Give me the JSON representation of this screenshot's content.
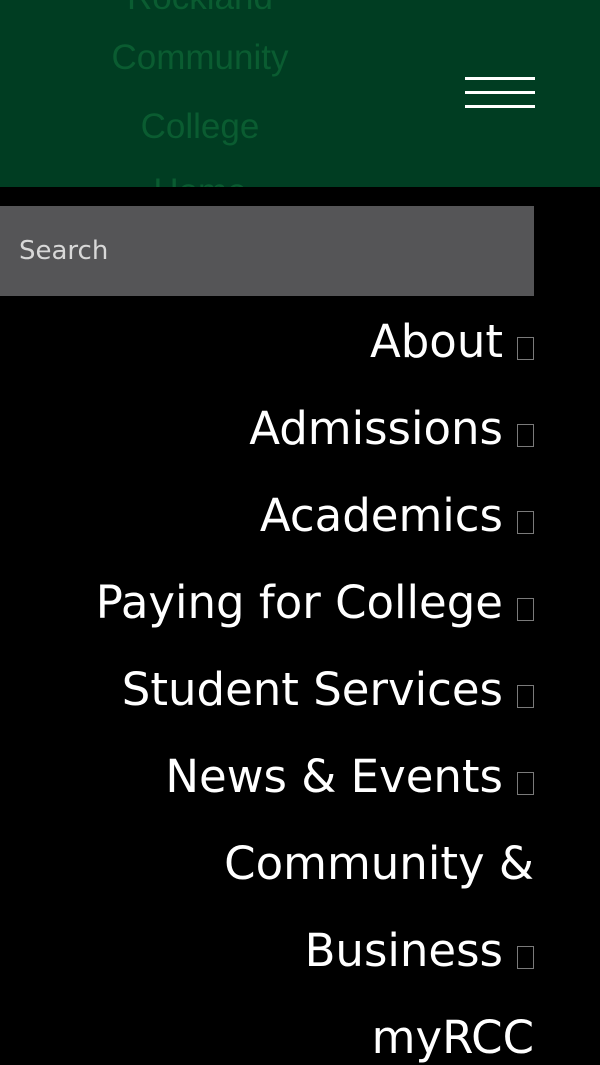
{
  "header": {
    "background_color": "#003d22",
    "logo_lines": [
      "Rockland",
      "Community",
      "College",
      "Home"
    ],
    "menu_icon": "hamburger-menu-icon"
  },
  "search": {
    "placeholder": "Search"
  },
  "nav": {
    "items": [
      {
        "label": "About",
        "has_submenu": true
      },
      {
        "label": "Admissions",
        "has_submenu": true
      },
      {
        "label": "Academics",
        "has_submenu": true
      },
      {
        "label": "Paying for College",
        "has_submenu": true
      },
      {
        "label": "Student Services",
        "has_submenu": true
      },
      {
        "label": "News & Events",
        "has_submenu": true
      },
      {
        "label": "Community &",
        "has_submenu": false
      },
      {
        "label": "Business",
        "has_submenu": true
      },
      {
        "label": "myRCC",
        "has_submenu": false
      }
    ],
    "submenu_icon": "expand-box-icon"
  }
}
